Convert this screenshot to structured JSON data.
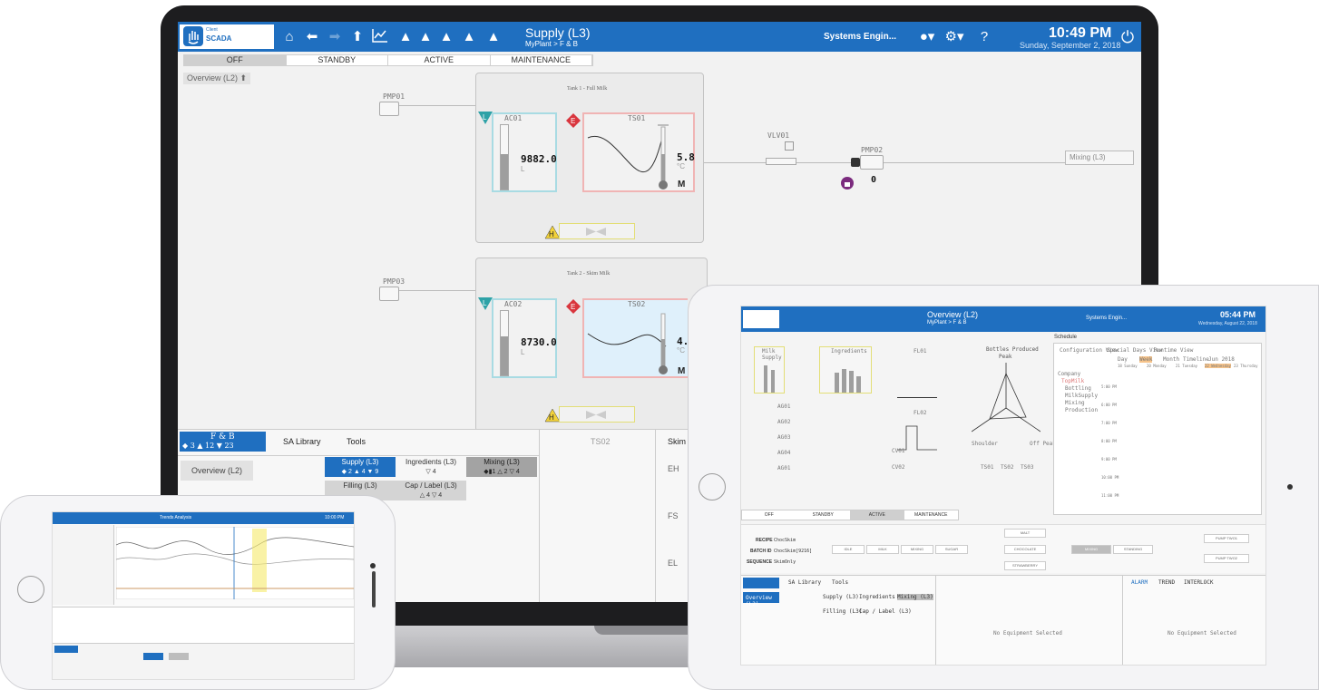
{
  "laptop": {
    "header": {
      "logo_line1": "Client",
      "logo_line2": "SCADA",
      "title": "Supply (L3)",
      "breadcrumb": "MyPlant > F & B",
      "user": "Systems Engin...",
      "time": "10:49 PM",
      "date": "Sunday, September 2, 2018"
    },
    "modes": [
      "OFF",
      "STANDBY",
      "ACTIVE",
      "MAINTENANCE"
    ],
    "selected_mode": "OFF",
    "overview_link": "Overview (L2)",
    "tank1": {
      "title": "Tank 1 - Full Milk",
      "level_tag": "AC01",
      "level_value": "9882.0",
      "level_unit": "L",
      "level_fill_fraction": 0.55,
      "temp_tag": "TS01",
      "temp_value": "5.8",
      "temp_unit": "°C",
      "mode": "M"
    },
    "tank2": {
      "title": "Tank 2 - Skim Milk",
      "level_tag": "AC02",
      "level_value": "8730.0",
      "level_unit": "L",
      "level_fill_fraction": 0.6,
      "temp_tag": "TS02",
      "temp_value": "4.",
      "temp_unit": "°C",
      "mode": "M"
    },
    "pumps": {
      "pmp01": "PMP01",
      "pmp02": "PMP02",
      "pmp03": "PMP03",
      "vlv01": "VLV01"
    },
    "pmp02_value": "0",
    "mixing_link": "Mixing (L3)",
    "bottom": {
      "area": "F & B",
      "area_counts": "◆ 3   ▲ 12   ▼ 23",
      "tabs": [
        "SA Library",
        "Tools"
      ],
      "overview": "Overview (L2)",
      "units": [
        {
          "name": "Supply (L3)",
          "counts": "◆ 2 ▲ 4 ▼ 9",
          "selected": true
        },
        {
          "name": "Ingredients (L3)",
          "counts": "▽ 4",
          "selected": false
        },
        {
          "name": "Mixing (L3)",
          "counts": "◆▮1 △ 2 ▽ 4",
          "selected": false
        },
        {
          "name": "Filling (L3)",
          "counts": "",
          "selected": false
        },
        {
          "name": "Cap / Label (L3)",
          "counts": "△ 4 ▽ 4",
          "selected": false
        }
      ],
      "ts_panel": "TS02",
      "skim_panel": "Skim I",
      "eh": "EH",
      "fs": "FS",
      "el": "EL"
    }
  },
  "ipad": {
    "header": {
      "title": "Overview (L2)",
      "breadcrumb": "MyPlant > F & B",
      "user": "Systems Engin...",
      "time": "05:44 PM",
      "date": "Wednesday, August 22, 2018"
    },
    "milk_supply": "Milk Supply",
    "ingredients": "Ingredients",
    "flow1": "FL01",
    "flow2": "FL02",
    "bottles": "Bottles Produced",
    "peak": "Peak",
    "shoulder": "Shoulder",
    "off_peak": "Off Peak",
    "schedule": "Schedule",
    "schedule_tabs": [
      "Configuration View",
      "Special Days View",
      "Runtime View"
    ],
    "schedule_views": [
      "Day",
      "Week",
      "Month",
      "Timeline"
    ],
    "schedule_month": "Jun 2018",
    "schedule_tree": [
      "Company",
      "TopMilk",
      "Bottling",
      "MilkSupply",
      "Mixing",
      "Production"
    ],
    "schedule_days": [
      "18 Sunday",
      "20 Monday",
      "21 Tuesday",
      "22 Wednesday",
      "23 Thursday"
    ],
    "schedule_times": [
      "5:00 PM",
      "6:00 PM",
      "7:00 PM",
      "8:00 PM",
      "9:00 PM",
      "10:00 PM",
      "11:00 PM"
    ],
    "valves": [
      "AG01",
      "AG02",
      "AG03",
      "AG04",
      "AG01"
    ],
    "ct": [
      "CV01",
      "CV02"
    ],
    "modes": [
      "OFF",
      "STANDBY",
      "ACTIVE",
      "MAINTENANCE"
    ],
    "selected_mode": "ACTIVE",
    "recipe_label": "RECIPE",
    "recipe": "ChocSkim",
    "batch_label": "BATCH ID",
    "batch": "ChocSkim[9216]",
    "sequence_label": "SEQUENCE",
    "sequence": "SkimOnly",
    "steps": [
      "IDLE",
      "MILK",
      "MIXING",
      "SUGAR",
      "MALT",
      "CHOCOLATE",
      "STRAWBERRY",
      "MIXING",
      "STANDING",
      "PUMP TWO1",
      "PUMP TWO2"
    ],
    "ts": [
      "TS01",
      "TS02",
      "TS03"
    ],
    "bottom_tabs": [
      "SA Library",
      "Tools"
    ],
    "right_tabs": [
      "ALARM",
      "TREND",
      "INTERLOCK"
    ],
    "no_equipment": "No Equipment Selected",
    "units": [
      "Supply (L3)",
      "Ingredients (L3)",
      "Mixing (L3)",
      "Filling (L3)",
      "Cap / Label (L3)"
    ],
    "overview": "Overview (L2)"
  },
  "iphone": {
    "title": "Trends Analysis",
    "time": "10:00 PM"
  }
}
